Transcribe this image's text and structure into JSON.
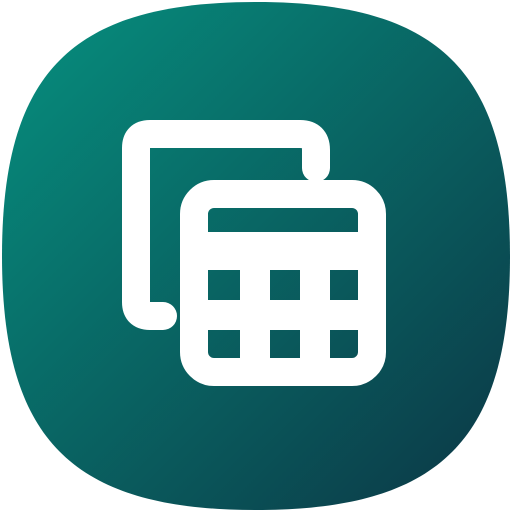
{
  "app_icon": {
    "icon": "calculator-copy-icon",
    "colors": {
      "gradient_start": "#06907f",
      "gradient_end": "#0c3645",
      "glyph": "#ffffff",
      "page_background": "#ffffff"
    }
  }
}
